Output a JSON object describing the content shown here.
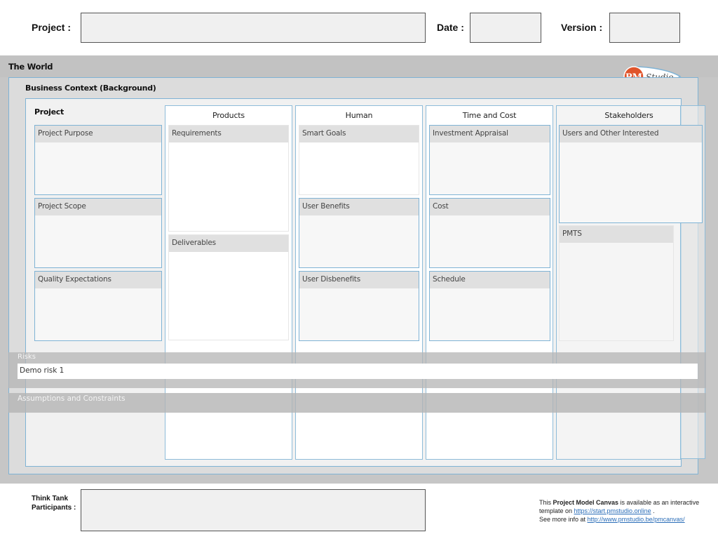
{
  "header": {
    "project_label": "Project :",
    "project_value": "",
    "date_label": "Date :",
    "date_value": "",
    "version_label": "Version :",
    "version_value": ""
  },
  "world": {
    "title": "The World",
    "logo": {
      "icon": "pm-studio-logo",
      "pm_text": "PM",
      "studio_text": "Studio",
      "accent": "#e0542b"
    }
  },
  "business_context": {
    "title": "Business Context (Background)"
  },
  "canvas": {
    "project": {
      "title": "Project",
      "boxes": [
        {
          "label": "Project Purpose"
        },
        {
          "label": "Project Scope"
        },
        {
          "label": "Quality Expectations"
        }
      ]
    },
    "products": {
      "title": "Products",
      "boxes": [
        {
          "label": "Requirements"
        },
        {
          "label": "Deliverables"
        }
      ]
    },
    "human": {
      "title": "Human",
      "boxes": [
        {
          "label": "Smart Goals"
        },
        {
          "label": "User Benefits"
        },
        {
          "label": "User Disbenefits"
        }
      ]
    },
    "time_cost": {
      "title": "Time and Cost",
      "boxes": [
        {
          "label": "Investment Appraisal"
        },
        {
          "label": "Cost"
        },
        {
          "label": "Schedule"
        }
      ]
    },
    "stakeholders": {
      "title": "Stakeholders",
      "boxes": [
        {
          "label": "Users and Other Interested"
        },
        {
          "label": "PMTS"
        }
      ]
    }
  },
  "risks": {
    "title": "Risks",
    "items": [
      "Demo risk 1"
    ]
  },
  "assumptions": {
    "title": "Assumptions and Constraints"
  },
  "footer": {
    "participants_label_1": "Think Tank",
    "participants_label_2": "Participants :",
    "participants_value": "",
    "note_prefix": "This ",
    "note_bold": "Project Model Canvas",
    "note_mid": " is available as an interactive template on ",
    "link1": "https://start.pmstudio.online",
    "note_after_link1": " .",
    "note_line3": "See more info at ",
    "link2": "http://www.pmstudio.be/pmcanvas/"
  },
  "colors": {
    "border_accent": "#7fb3d5",
    "world_bg": "#c6c6c6",
    "context_bg": "#dcdcdc",
    "box_head_bg": "#e0e0e0",
    "logo_orange": "#e0542b"
  }
}
